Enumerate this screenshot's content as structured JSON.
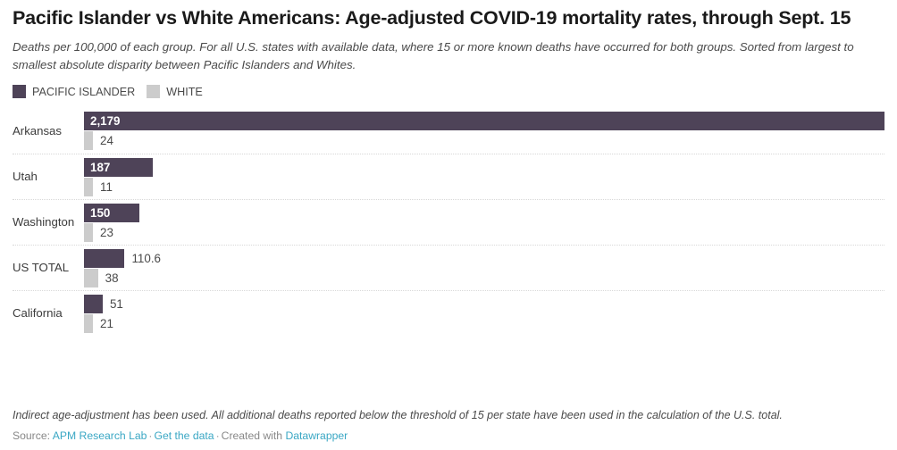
{
  "header": {
    "title": "Pacific Islander vs White Americans: Age-adjusted COVID-19 mortality rates, through Sept. 15",
    "subtitle": "Deaths per 100,000 of each group. For all U.S. states with available data, where 15 or more known deaths have occurred for both groups. Sorted from largest to smallest absolute disparity between Pacific Islanders and Whites."
  },
  "legend": {
    "items": [
      {
        "label": "PACIFIC ISLANDER",
        "color": "#4e4358"
      },
      {
        "label": "WHITE",
        "color": "#cccccc"
      }
    ]
  },
  "footer": {
    "footnote": "Indirect age-adjustment has been used. All additional deaths reported below the threshold of 15 per state have been used in the calculation of the U.S. total.",
    "source_prefix": "Source:",
    "source_name": "APM Research Lab",
    "get_data": "Get the data",
    "created_with": "Created with",
    "tool": "Datawrapper",
    "link_color": "#3aa7c4"
  },
  "chart_data": {
    "type": "bar",
    "title": "Pacific Islander vs White Americans: Age-adjusted COVID-19 mortality rates, through Sept. 15",
    "subtitle": "Deaths per 100,000 of each group. For all U.S. states with available data, where 15 or more known deaths have occurred for both groups. Sorted from largest to smallest absolute disparity between Pacific Islanders and Whites.",
    "orientation": "horizontal",
    "grouped": true,
    "xlabel": "",
    "ylabel": "",
    "xlim": [
      0,
      2179
    ],
    "grid": false,
    "legend_position": "top-left",
    "categories": [
      "Arkansas",
      "Utah",
      "Washington",
      "US TOTAL",
      "California"
    ],
    "series": [
      {
        "name": "PACIFIC ISLANDER",
        "color": "#4e4358",
        "values": [
          2179,
          187,
          150,
          110.6,
          51
        ],
        "labels": [
          "2,179",
          "187",
          "150",
          "110.6",
          "51"
        ]
      },
      {
        "name": "WHITE",
        "color": "#cccccc",
        "values": [
          24,
          11,
          23,
          38,
          21
        ],
        "labels": [
          "24",
          "11",
          "23",
          "38",
          "21"
        ]
      }
    ]
  }
}
